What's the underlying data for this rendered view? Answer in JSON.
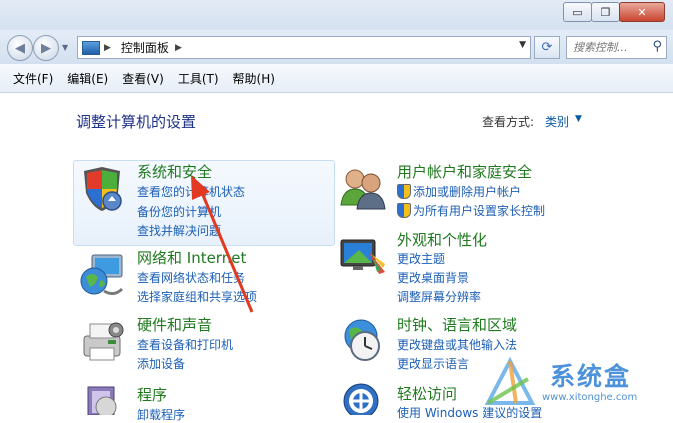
{
  "window": {
    "buttons": {
      "minimize": "▭",
      "restore": "❐",
      "close": "✕"
    }
  },
  "address": {
    "back_icon": "◀",
    "forward_icon": "▶",
    "breadcrumb": "控制面板",
    "refresh_icon": "⟳",
    "search_placeholder": "搜索控制..."
  },
  "menu": [
    "文件(F)",
    "编辑(E)",
    "查看(V)",
    "工具(T)",
    "帮助(H)"
  ],
  "main": {
    "heading": "调整计算机的设置",
    "view_by_label": "查看方式:",
    "view_by_value": "类别"
  },
  "categories": [
    {
      "title": "系统和安全",
      "links": [
        "查看您的计算机状态",
        "备份您的计算机",
        "查找并解决问题"
      ]
    },
    {
      "title": "网络和 Internet",
      "links": [
        "查看网络状态和任务",
        "选择家庭组和共享选项"
      ]
    },
    {
      "title": "硬件和声音",
      "links": [
        "查看设备和打印机",
        "添加设备"
      ]
    },
    {
      "title": "程序",
      "links": [
        "卸载程序"
      ]
    },
    {
      "title": "用户帐户和家庭安全",
      "links": [
        "添加或删除用户帐户",
        "为所有用户设置家长控制"
      ]
    },
    {
      "title": "外观和个性化",
      "links": [
        "更改主题",
        "更改桌面背景",
        "调整屏幕分辨率"
      ]
    },
    {
      "title": "时钟、语言和区域",
      "links": [
        "更改键盘或其他输入法",
        "更改显示语言"
      ]
    },
    {
      "title": "轻松访问",
      "links": [
        "使用 Windows 建议的设置"
      ]
    }
  ],
  "watermark": {
    "name": "系统盒",
    "url": "www.xitonghe.com"
  },
  "colors": {
    "category_title": "#1f7a1f",
    "link": "#1c5fb5",
    "heading": "#1e3287",
    "annotation_arrow": "#e23a22"
  }
}
